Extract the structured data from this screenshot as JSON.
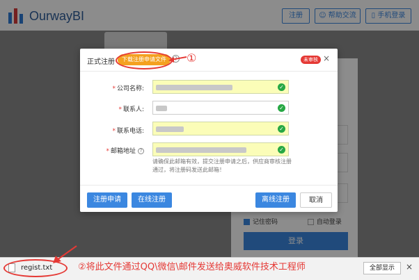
{
  "header": {
    "logo_text": "OurwayBI",
    "register_label": "注册",
    "help_label": "帮助交流",
    "phone_login_label": "手机登录"
  },
  "login_card": {
    "remember_label": "记住密码",
    "auto_login_label": "自动登录",
    "login_button": "登录"
  },
  "modal": {
    "title": "正式注册",
    "download_button": "下载注册申请文件",
    "help_icon": "question-circle-icon",
    "status_badge": "未审核",
    "close_icon": "close-icon",
    "fields": [
      {
        "label": "公司名称:",
        "required": "*",
        "verified": true,
        "placeholder_style": "filled"
      },
      {
        "label": "联系人:",
        "required": "*",
        "verified": true,
        "placeholder_style": "plain"
      },
      {
        "label": "联系电话:",
        "required": "*",
        "verified": true,
        "placeholder_style": "filled"
      },
      {
        "label": "邮箱地址",
        "required": "*",
        "verified": true,
        "placeholder_style": "filled"
      }
    ],
    "note": "请确保此邮箱有效，提交注册申请之后，供应商审核注册通过，将注册码发送此邮箱！",
    "buttons": {
      "apply": "注册申请",
      "online": "在线注册",
      "offline": "离线注册",
      "cancel": "取消"
    }
  },
  "annotations": {
    "step1": "①",
    "step2": "②将此文件通过QQ\\微信\\邮件发送给奥威软件技术工程师"
  },
  "download_bar": {
    "file_name": "regist.txt",
    "show_all": "全部显示",
    "close": "×"
  },
  "colors": {
    "primary": "#3b87e0",
    "accent_orange": "#f4a11f",
    "badge_red": "#e53935",
    "field_highlight": "#fbfdb8",
    "ok_green": "#27a844"
  }
}
